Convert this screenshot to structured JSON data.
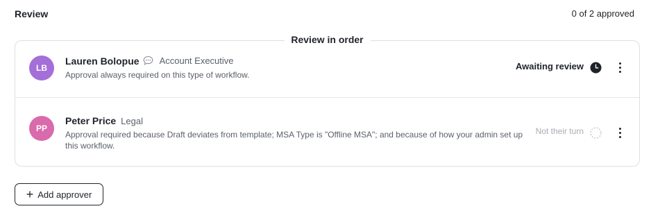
{
  "header": {
    "title": "Review",
    "approved_count": "0 of 2 approved"
  },
  "review_order_label": "Review in order",
  "approvers": [
    {
      "initials": "LB",
      "avatar_color": "#a46fd8",
      "name": "Lauren Bolopue",
      "role": "Account Executive",
      "has_comment_icon": true,
      "reason": "Approval always required on this type of workflow.",
      "status": "Awaiting review",
      "status_icon": "clock-icon"
    },
    {
      "initials": "PP",
      "avatar_color": "#d96aab",
      "name": "Peter Price",
      "role": "Legal",
      "has_comment_icon": false,
      "reason": "Approval required because Draft deviates from template; MSA Type is \"Offline MSA\"; and because of how your admin set up this workflow.",
      "status": "Not their turn",
      "status_icon": "pending-circle-icon"
    }
  ],
  "add_approver_button": {
    "icon": "plus-icon",
    "label": "Add approver"
  },
  "colors": {
    "text_primary": "#1f2328",
    "text_secondary": "#5a6069",
    "text_muted": "#a8adb3",
    "border": "#dcdfe3"
  }
}
